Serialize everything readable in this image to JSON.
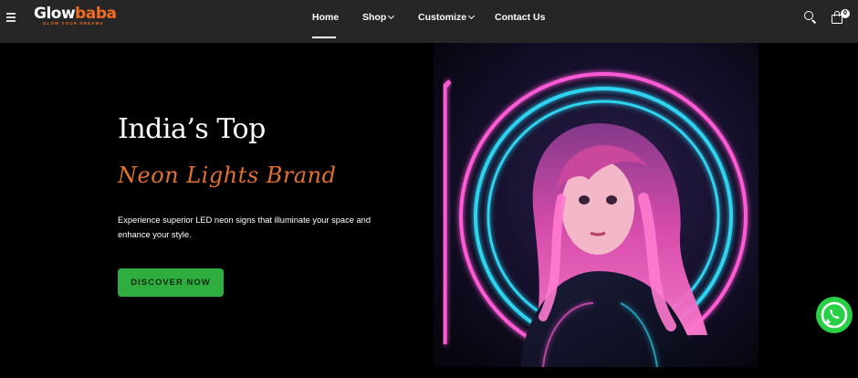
{
  "header": {
    "logo_text_start": "Glow",
    "logo_text_end": "baba",
    "logo_tagline": "GLOW YOUR DREAMS",
    "nav": [
      {
        "label": "Home"
      },
      {
        "label": "Shop"
      },
      {
        "label": "Customize"
      },
      {
        "label": "Contact Us"
      }
    ],
    "cart_count": "0"
  },
  "hero": {
    "title": "India’s Top",
    "script_subtitle": "Neon Lights Brand",
    "description": "Experience superior LED neon signs that illuminate your space and enhance your style.",
    "cta_label": "DISCOVER NOW"
  },
  "colors": {
    "header_bg": "#262626",
    "page_bg": "#000000",
    "accent_orange": "#e2712e",
    "cta_green": "#2fae3f",
    "whatsapp_green": "#27d045"
  },
  "icons": {
    "menu": "hamburger-icon",
    "search": "search-icon",
    "cart": "shopping-bag-icon",
    "chat": "whatsapp-icon"
  }
}
